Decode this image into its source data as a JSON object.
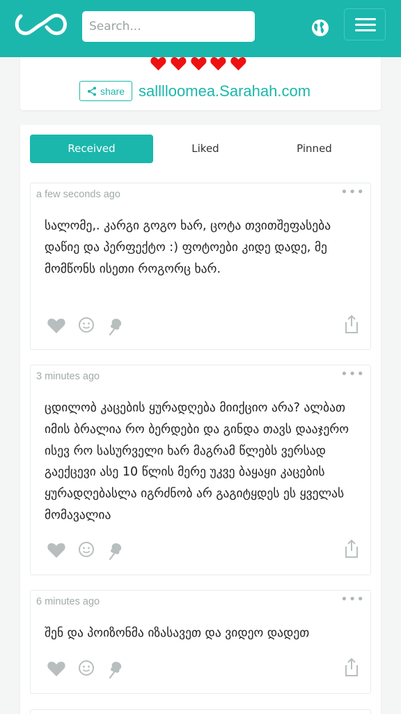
{
  "header": {
    "search_placeholder": "Search...",
    "brand_color": "#1bb7ac"
  },
  "profile": {
    "rating_hearts": 5,
    "share_label": "share",
    "url": "salllloomea.Sarahah.com"
  },
  "tabs": [
    {
      "label": "Received",
      "active": true
    },
    {
      "label": "Liked",
      "active": false
    },
    {
      "label": "Pinned",
      "active": false
    }
  ],
  "messages": [
    {
      "time": "a few seconds ago",
      "text": "სალომე,. კარგი გოგო ხარ, ცოტა თვითშეფასება დაწიე და პერფექტო :) ფოტოები კიდე დადე, მე მომწონს ისეთი როგორც ხარ."
    },
    {
      "time": "3 minutes ago",
      "text": "ცდილობ კაცების ყურადღება მიიქციო არა? ალბათ იმის ბრალია რო ბერდები და გინდა თავს დააჯერო ისევ რო სასურველი ხარ მაგრამ წლებს ვერსად გაექცევი ასე 10 წლის მერე უკვე ბაყაყი კაცების ყურადღებასლა იგრძნობ არ გაგიტყდეს ეს ყველას მომავალია"
    },
    {
      "time": "6 minutes ago",
      "text": "შენ და პოიზონმა იზასავეთ და ვიდეო დადეთ"
    }
  ],
  "icons": {
    "logo": "infinity-logo-icon",
    "globe": "globe-icon",
    "menu": "hamburger-menu-icon",
    "like": "heart-icon",
    "react": "smiley-icon",
    "pin": "pin-icon",
    "share": "share-icon",
    "more": "more-dots-icon"
  }
}
